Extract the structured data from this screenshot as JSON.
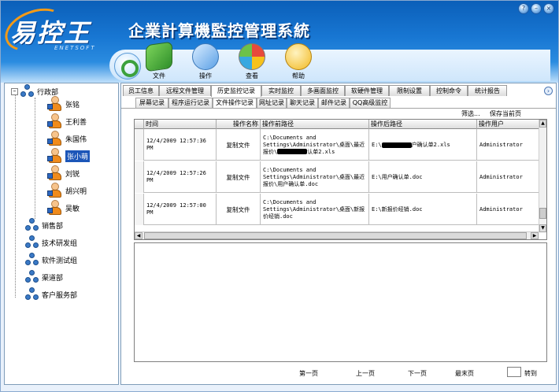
{
  "app": {
    "logo_text": "易控王",
    "logo_en": "ENETSOFT",
    "title": "企業計算機監控管理系統"
  },
  "toolbar": {
    "items": [
      {
        "label": "文件",
        "icon": "file-icon"
      },
      {
        "label": "操作",
        "icon": "operation-icon"
      },
      {
        "label": "查看",
        "icon": "view-icon"
      },
      {
        "label": "帮助",
        "icon": "help-icon"
      }
    ]
  },
  "sidebar": {
    "root": "行政部",
    "users": [
      "张铭",
      "王利善",
      "朱国伟",
      "张小萌",
      "刘锐",
      "胡兴明",
      "吴敏"
    ],
    "selected_user": "张小萌",
    "groups": [
      "销售部",
      "技术研发组",
      "软件测试组",
      "渠道部",
      "客户服务部"
    ]
  },
  "tabs": {
    "primary": [
      "员工信息",
      "远程文件管理",
      "历史监控记录",
      "实时监控",
      "多画面监控",
      "软硬件管理",
      "限制设置",
      "控制命令",
      "统计报告"
    ],
    "primary_active": "历史监控记录",
    "secondary": [
      "屏幕记录",
      "程序运行记录",
      "文件操作记录",
      "网址记录",
      "聊天记录",
      "邮件记录",
      "QQ高级监控"
    ],
    "secondary_active": "文件操作记录"
  },
  "actions": {
    "filter": "筛选...",
    "save_page": "保存当前页"
  },
  "table": {
    "columns": [
      "时间",
      "操作名称",
      "操作前路径",
      "操作后路径",
      "操作用户"
    ],
    "rows": [
      {
        "time": "12/4/2009 12:57:36 PM",
        "action": "复制文件",
        "before_1": "C:\\Documents and",
        "before_2": "Settings\\Administrator\\桌面\\最近",
        "before_3": "报价\\",
        "before_3_tail": "认单2.xls",
        "after_1": "E:\\",
        "after_tail": "户确认单2.xls",
        "user": "Administrator"
      },
      {
        "time": "12/4/2009 12:57:26 PM",
        "action": "复制文件",
        "before_1": "C:\\Documents and",
        "before_2": "Settings\\Administrator\\桌面\\最近",
        "before_3": "报价\\用户确认单.doc",
        "after": "E:\\用户确认单.doc",
        "user": "Administrator"
      },
      {
        "time": "12/4/2009 12:57:00 PM",
        "action": "复制文件",
        "before_1": "C:\\Documents and",
        "before_2": "Settings\\Administrator\\桌面\\新报",
        "before_3": "价经销.doc",
        "after": "E:\\新报价经销.doc",
        "user": "Administrator"
      }
    ]
  },
  "pager": {
    "first": "第一页",
    "prev": "上一页",
    "next": "下一页",
    "last": "最末页",
    "goto": "转到"
  },
  "window_buttons": [
    "help",
    "minimize",
    "close"
  ]
}
